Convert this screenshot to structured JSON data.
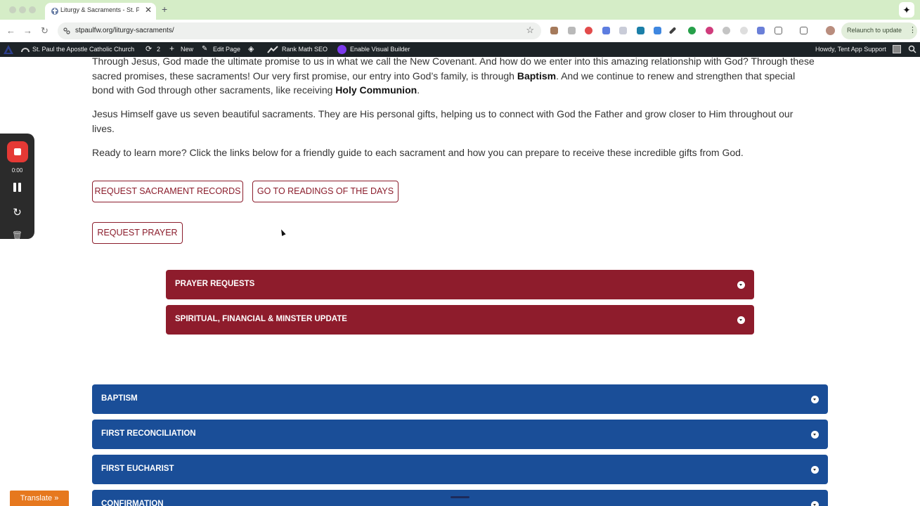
{
  "browser": {
    "tab_title": "Liturgy & Sacraments - St. Paul the Apostle",
    "tab_close": "✕",
    "new_tab": "+",
    "url": "stpaulfw.org/liturgy-sacraments/",
    "relaunch_label": "Relaunch to update",
    "nav": {
      "back": "←",
      "forward": "→",
      "reload": "↻"
    },
    "star": "☆",
    "gemini": "✦",
    "menu": "⋮"
  },
  "admin_bar": {
    "site_name": "St. Paul the Apostle Catholic Church",
    "updates_count": "2",
    "new_label": "New",
    "edit_page": "Edit Page",
    "rank_math": "Rank Math SEO",
    "visual_builder": "Enable Visual Builder",
    "howdy": "Howdy, Tent App Support"
  },
  "content": {
    "p1_a": "Through Jesus, God made the ultimate promise to us in what we call the New Covenant. And how do we enter into this amazing relationship with God? Through these sacred promises, these sacraments! Our very first promise, our entry into God’s family, is through ",
    "p1_b1": "Baptism",
    "p1_c": ". And we continue to renew and strengthen that special bond with God through other sacraments, like receiving ",
    "p1_b2": "Holy Communion",
    "p1_d": ".",
    "p2": "Jesus Himself gave us seven beautiful sacraments. They are His personal gifts, helping us to connect with God the Father and grow closer to Him throughout our lives.",
    "p3": "Ready to learn more? Click the links below for a friendly guide to each sacrament and how you can prepare to receive these incredible gifts from God."
  },
  "buttons": {
    "sacrament_records": "REQUEST SACRAMENT RECORDS",
    "readings": "GO TO READINGS OF THE DAYS",
    "prayer": "REQUEST PRAYER"
  },
  "accordions_red": [
    "PRAYER REQUESTS",
    "SPIRITUAL, FINANCIAL & MINSTER UPDATE"
  ],
  "accordions_blue": [
    "BAPTISM",
    "FIRST RECONCILIATION",
    "FIRST EUCHARIST",
    "CONFIRMATION"
  ],
  "recorder": {
    "time": "0:00",
    "restart": "↻",
    "trash": "🗑"
  },
  "translate_label": "Translate »",
  "colors": {
    "accent_red": "#8e1c2c",
    "accent_blue": "#1a4e98",
    "admin_bar": "#1d2327",
    "tab_bar": "#d5edc7"
  }
}
